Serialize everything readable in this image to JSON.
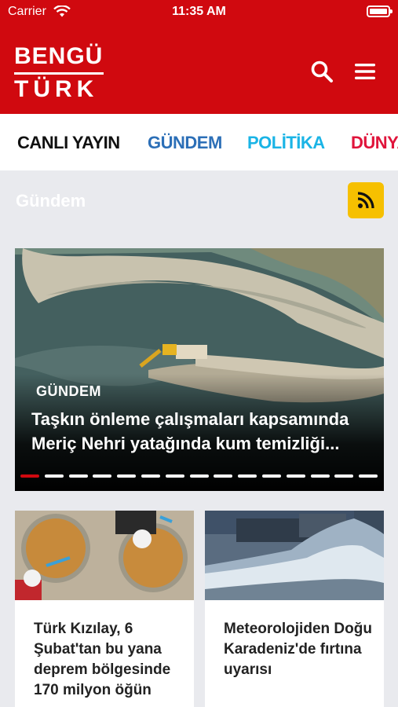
{
  "status_bar": {
    "carrier": "Carrier",
    "time": "11:35 AM"
  },
  "header": {
    "logo_line1": "BENGÜ",
    "logo_line2": "TÜRK",
    "brand_color": "#d0090f"
  },
  "tabs": [
    {
      "label": "CANLI YAYIN",
      "color": "#111111"
    },
    {
      "label": "GÜNDEM",
      "color": "#2c6fb7"
    },
    {
      "label": "POLİTİKA",
      "color": "#1ab4e6"
    },
    {
      "label": "DÜNYA",
      "color": "#e0143b"
    }
  ],
  "section": {
    "title": "Gündem",
    "rss_icon": "rss-icon",
    "rss_color": "#f6c000"
  },
  "hero": {
    "category": "GÜNDEM",
    "title": "Taşkın önleme çalışmaları kapsamında Meriç Nehri yatağında kum temizliği...",
    "slide_count": 15,
    "active_slide": 1
  },
  "cards": [
    {
      "title": "Türk Kızılay, 6 Şubat'tan bu yana deprem bölgesinde 170 milyon öğün"
    },
    {
      "title": "Meteorolojiden Doğu Karadeniz'de fırtına uyarısı"
    }
  ]
}
